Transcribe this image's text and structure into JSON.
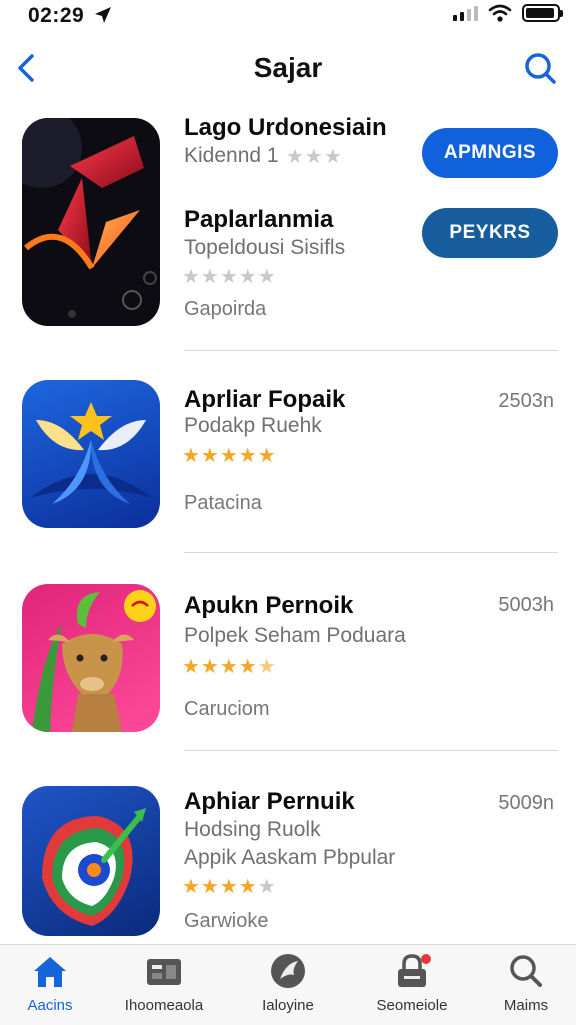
{
  "status_bar": {
    "time": "02:29"
  },
  "nav": {
    "title": "Sajar"
  },
  "featured": {
    "app1": {
      "name": "Lago Urdonesiain",
      "sub": "Kidennd 1",
      "rating": 0,
      "button": "APMNGIS"
    },
    "app2": {
      "name": "Paplarlanmia",
      "sub": "Topeldousi Sisifls",
      "rating": 0,
      "category": "Gapoirda",
      "button": "PEYKRS"
    }
  },
  "apps": [
    {
      "name": "Aprliar Fopaik",
      "sub": "Podakp Ruehk",
      "rating": 5,
      "category": "Patacina",
      "size": "2503n"
    },
    {
      "name": "Apukn Pernoik",
      "sub": "Polpek Seham Poduara",
      "rating": 4.5,
      "category": "Caruciom",
      "size": "5003h"
    },
    {
      "name": "Aphiar Pernuik",
      "sub": "Hodsing Ruolk",
      "sub2": "Appik Aaskam Pbpular",
      "rating": 4,
      "category": "Garwioke",
      "size": "5009n"
    }
  ],
  "tabs": [
    {
      "label": "Aacins",
      "icon": "home-icon"
    },
    {
      "label": "Ihoomeaola",
      "icon": "film-icon"
    },
    {
      "label": "Ialoyine",
      "icon": "game-icon"
    },
    {
      "label": "Seomeiole",
      "icon": "lock-icon"
    },
    {
      "label": "Maims",
      "icon": "search-icon"
    }
  ],
  "colors": {
    "accent": "#1565d8",
    "button1": "#1161dc",
    "button2": "#175d9e",
    "star": "#f5a623"
  }
}
